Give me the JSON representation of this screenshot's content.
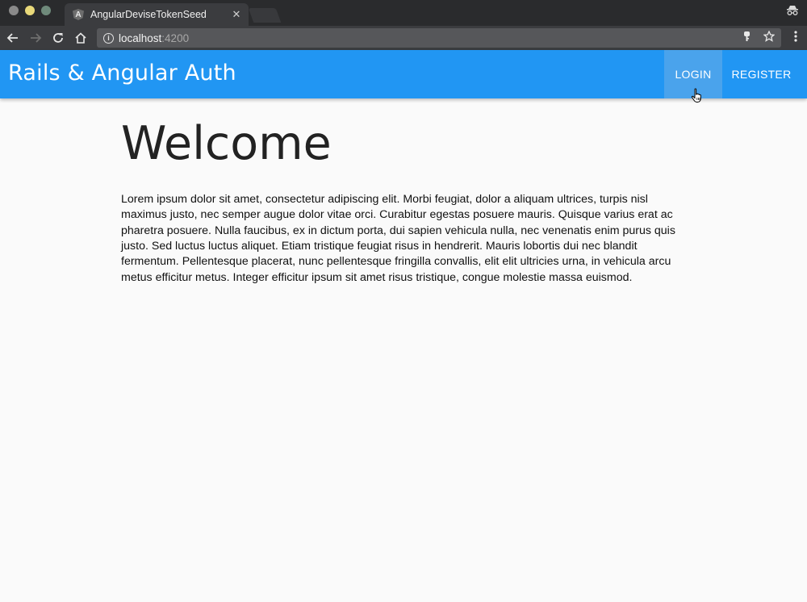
{
  "browser": {
    "tab_title": "AngularDeviseTokenSeed",
    "tab_favicon": "A",
    "tab_close": "✕",
    "url_host": "localhost",
    "url_port": ":4200"
  },
  "navbar": {
    "title": "Rails & Angular Auth",
    "login_label": "LOGIN",
    "register_label": "REGISTER",
    "color": "#2196f3"
  },
  "main": {
    "heading": "Welcome",
    "paragraph": "Lorem ipsum dolor sit amet, consectetur adipiscing elit. Morbi feugiat, dolor a aliquam ultrices, turpis nisl maximus justo, nec semper augue dolor vitae orci. Curabitur egestas posuere mauris. Quisque varius erat ac pharetra posuere. Nulla faucibus, ex in dictum porta, dui sapien vehicula nulla, nec venenatis enim purus quis justo. Sed luctus luctus aliquet. Etiam tristique feugiat risus in hendrerit. Mauris lobortis dui nec blandit fermentum. Pellentesque placerat, nunc pellentesque fringilla convallis, elit elit ultricies urna, in vehicula arcu metus efficitur metus. Integer efficitur ipsum sit amet risus tristique, congue molestie massa euismod."
  },
  "icons": {
    "back": "back-arrow-icon",
    "forward": "forward-arrow-icon",
    "reload": "reload-icon",
    "home": "home-icon",
    "info": "info-icon",
    "key": "key-icon",
    "star": "star-icon",
    "menu": "kebab-menu-icon",
    "incognito": "incognito-icon",
    "cursor": "pointer-hand-cursor-icon"
  }
}
